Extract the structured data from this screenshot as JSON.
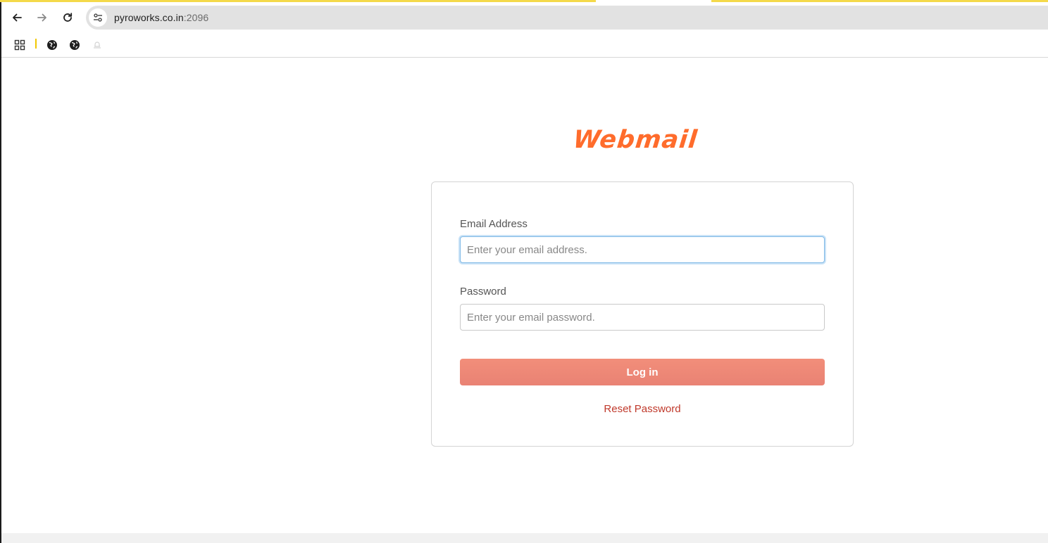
{
  "browser": {
    "url_host": "pyroworks.co.in",
    "url_port": ":2096",
    "back_icon": "arrow-left-icon",
    "forward_icon": "arrow-right-icon",
    "reload_icon": "reload-icon",
    "site_info_icon": "tune-icon",
    "bookmarks": [
      {
        "icon": "apps-grid-icon"
      },
      {
        "icon": "globe-icon"
      },
      {
        "icon": "globe-icon"
      },
      {
        "icon": "placeholder-icon"
      }
    ]
  },
  "login": {
    "logo_text": "Webmail",
    "email_label": "Email Address",
    "email_placeholder": "Enter your email address.",
    "password_label": "Password",
    "password_placeholder": "Enter your email password.",
    "login_button": "Log in",
    "reset_link": "Reset Password"
  },
  "colors": {
    "brand_orange": "#ff6c2c",
    "button": "#f28e7a",
    "link": "#c0392b",
    "focus_ring": "#7fb9e6"
  }
}
